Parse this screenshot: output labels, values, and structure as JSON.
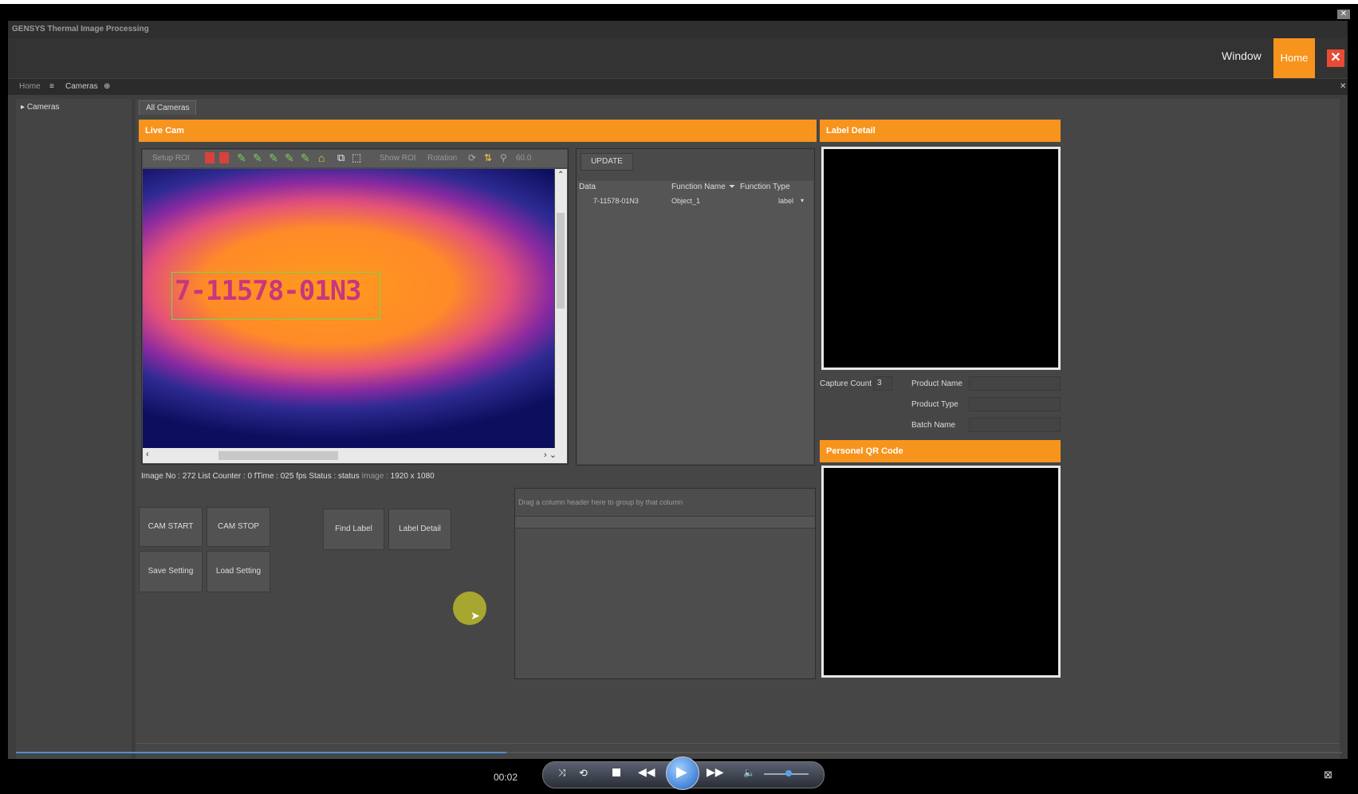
{
  "app": {
    "title": "GENSYS Thermal Image Processing"
  },
  "ribbon": {
    "window_label": "Window",
    "home_label": "Home",
    "close_glyph": "✕"
  },
  "doc_tabs": {
    "home": "Home",
    "cameras": "Cameras"
  },
  "sidebar": {
    "items": [
      {
        "label": "Cameras"
      }
    ]
  },
  "content_tab": "All Cameras",
  "live_cam": {
    "header": "Live Cam",
    "toolbar": {
      "setup_roi": "Setup ROI",
      "show_roi": "Show ROI",
      "rotation": "Rotation",
      "zoom": "60.0"
    },
    "ocr_text": "7-11578-01N3"
  },
  "status_bar": {
    "image_no_label": "Image No :",
    "image_no": "272",
    "list_counter_label": "List Counter :",
    "list_counter": "0",
    "ftime_label": "fTime :",
    "ftime": "025 fps",
    "status_label": "Status :",
    "status": "status",
    "image_label": "Image :",
    "image_size": "1920 x 1080"
  },
  "results": {
    "update_label": "UPDATE",
    "columns": [
      "Data",
      "Function Name",
      "Function Type"
    ],
    "rows": [
      {
        "data": "7-11578-01N3",
        "function_name": "Object_1",
        "function_type": "label"
      }
    ]
  },
  "buttons": {
    "cam_start": "CAM START",
    "cam_stop": "CAM STOP",
    "save_setting": "Save Setting",
    "load_setting": "Load Setting",
    "find_label": "Find Label",
    "label_detail": "Label Detail"
  },
  "grid": {
    "group_hint": "Drag a column header here to group by that column"
  },
  "label_detail": {
    "header": "Label Detail",
    "capture_count_label": "Capture Count",
    "capture_count": "3",
    "product_name_label": "Product Name",
    "product_type_label": "Product Type",
    "batch_name_label": "Batch Name"
  },
  "qr": {
    "header": "Personel QR Code"
  },
  "player": {
    "time": "00:02",
    "progress": 0.37
  },
  "colors": {
    "accent": "#f7941d",
    "close": "#e94b35",
    "background": "#3e3e3e"
  }
}
